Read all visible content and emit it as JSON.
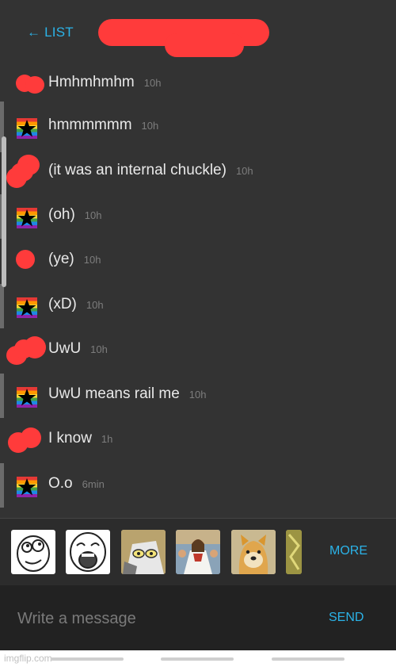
{
  "header": {
    "back_label": "← LIST"
  },
  "messages": [
    {
      "author": "other",
      "text": "Hmhmhmhm",
      "time": "10h"
    },
    {
      "author": "self",
      "text": "hmmmmmm",
      "time": "10h"
    },
    {
      "author": "other",
      "text": "(it was an internal chuckle)",
      "time": "10h"
    },
    {
      "author": "self",
      "text": "(oh)",
      "time": "10h"
    },
    {
      "author": "other",
      "text": "(ye)",
      "time": "10h"
    },
    {
      "author": "self",
      "text": "(xD)",
      "time": "10h"
    },
    {
      "author": "other",
      "text": "UwU",
      "time": "10h"
    },
    {
      "author": "self",
      "text": "UwU means rail me",
      "time": "10h"
    },
    {
      "author": "other",
      "text": "I know",
      "time": "1h"
    },
    {
      "author": "self",
      "text": "O.o",
      "time": "6min"
    }
  ],
  "emoji_bar": {
    "stickers": [
      "derp-face",
      "lol-face",
      "unsettled-tom",
      "buddy-christ",
      "doge",
      "partial-sticker"
    ],
    "more_label": "MORE"
  },
  "composer": {
    "placeholder": "Write a message",
    "send_label": "SEND"
  },
  "footer": {
    "watermark": "imgflip.com"
  },
  "colors": {
    "accent": "#2bb3e8",
    "background": "#333333",
    "redaction": "#ff3b3b"
  }
}
